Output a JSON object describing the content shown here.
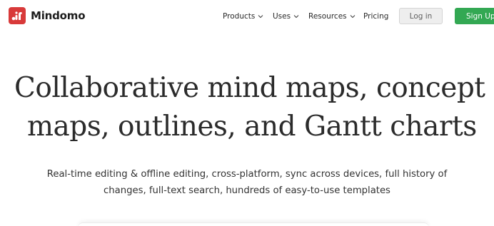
{
  "header": {
    "brand": "Mindomo",
    "nav": [
      {
        "label": "Products",
        "icon": "chevron-down-icon"
      },
      {
        "label": "Uses",
        "icon": "chevron-down-icon"
      },
      {
        "label": "Resources",
        "icon": "chevron-down-icon"
      },
      {
        "label": "Pricing"
      }
    ],
    "login_label": "Log in",
    "signup_label": "Sign Up"
  },
  "hero": {
    "title_line1": "Collaborative mind maps, concept",
    "title_line2": "maps, outlines, and Gantt charts",
    "subtitle_line1": "Real-time editing & offline editing, cross-platform, sync across devices, full history of",
    "subtitle_line2": "changes, full-text search, hundreds of easy-to-use templates"
  },
  "colors": {
    "brand_red": "#d83a3a",
    "signup_green": "#33a853",
    "login_gray": "#eeeeee"
  }
}
